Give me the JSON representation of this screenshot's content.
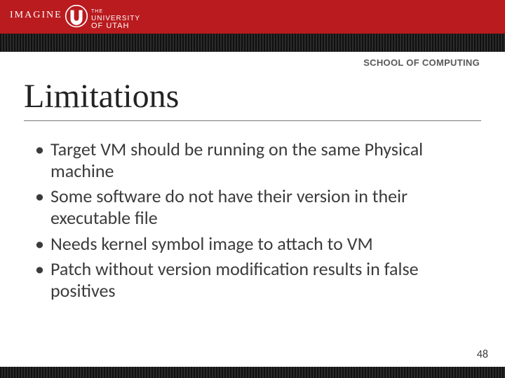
{
  "header": {
    "imagine": "IMAGINE",
    "university_the": "THE",
    "university_name": "UNIVERSITY",
    "university_of_utah": "OF UTAH"
  },
  "subheader": "SCHOOL OF COMPUTING",
  "title": "Limitations",
  "bullets": [
    "Target VM should be running on the same Physical machine",
    "Some software do not have their version in their executable file",
    "Needs kernel symbol image to attach to VM",
    "Patch without version modification results in false positives"
  ],
  "page_number": "48",
  "colors": {
    "brand_red": "#b91b1f"
  }
}
